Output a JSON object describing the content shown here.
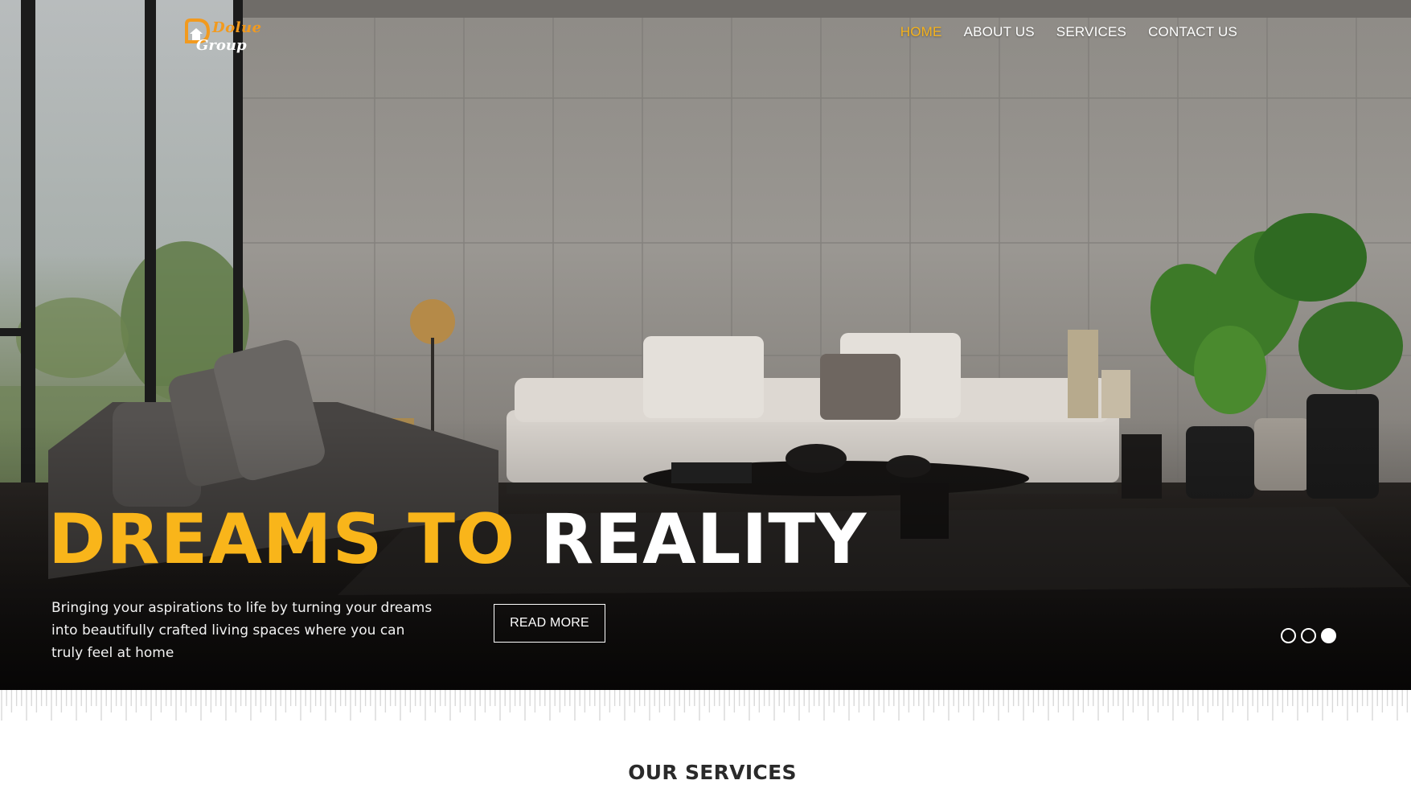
{
  "brand": {
    "logo_line_1": "Dolue",
    "logo_line_2": "Group",
    "accent_color": "#f29a1e"
  },
  "nav": {
    "items": [
      {
        "label": "HOME",
        "active": true
      },
      {
        "label": "ABOUT US",
        "active": false
      },
      {
        "label": "SERVICES",
        "active": false
      },
      {
        "label": "CONTACT US",
        "active": false
      }
    ],
    "active_color": "#f5b21c"
  },
  "hero": {
    "headline_part_1": "DREAMS TO",
    "headline_part_2": "REALITY",
    "headline_accent_color": "#f9b51a",
    "subtext": "Bringing your aspirations to life by turning your dreams into beautifully crafted living spaces where you can truly feel at home",
    "button_label": "READ MORE",
    "slider": {
      "total": 3,
      "active_index": 2
    }
  },
  "services_section": {
    "title": "OUR SERVICES"
  }
}
